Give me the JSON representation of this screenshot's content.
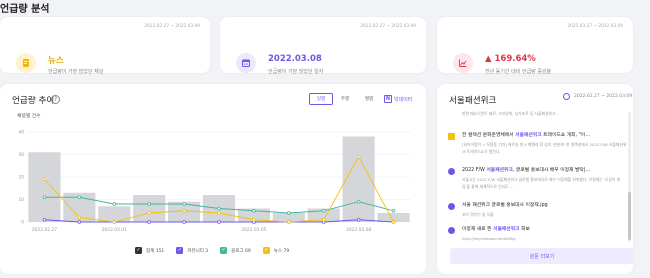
{
  "page": {
    "title": "언급량 분석"
  },
  "kpis": [
    {
      "date": "2022.02.27 ~ 2022.03.09",
      "value": "뉴스",
      "desc": "언급량이 가장 많았던 채널",
      "color": "#f3b515"
    },
    {
      "date": "2022.02.27 ~ 2022.03.09",
      "value": "2022.03.08",
      "desc": "언급량이 가장 많았던 일자",
      "color": "#6e58e9"
    },
    {
      "date": "2021.03.27 ~ 2022.03.09",
      "value": "▲ 169.64%",
      "desc": "전년 동기간 대비 언급량 증감율",
      "color": "#e0364a"
    }
  ],
  "trend": {
    "title": "언급량 추이",
    "help": "?",
    "tabs": [
      "일별",
      "주별",
      "월별"
    ],
    "active_tab": "일별",
    "bigdata_icon": "N",
    "bigdata_label": "빅데이터",
    "y_label": "채널별 건수"
  },
  "chart_data": {
    "type": "bar",
    "x": [
      "2022.02.27",
      "2022.02.28",
      "2022.03.01",
      "2022.03.02",
      "2022.03.03",
      "2022.03.04",
      "2022.03.05",
      "2022.03.06",
      "2022.03.07",
      "2022.03.08",
      "2022.03.09"
    ],
    "x_tick_labels": [
      "2022.02.27",
      "2022.03.01",
      "2022.03.05",
      "2022.03.08"
    ],
    "x_tick_index": [
      0,
      2,
      6,
      9
    ],
    "y_ticks": [
      0,
      10,
      20,
      30,
      40
    ],
    "ylim": [
      0,
      40
    ],
    "series": [
      {
        "name": "합계",
        "count": "151",
        "type": "bar",
        "color": "#d4d6da",
        "values": [
          31,
          13,
          7,
          12,
          9,
          12,
          6,
          4,
          6,
          38,
          4
        ]
      },
      {
        "name": "커뮤니티",
        "count": "3",
        "type": "line",
        "color": "#6e58e9",
        "values": [
          1,
          0,
          0,
          0,
          0,
          0,
          0,
          0,
          0,
          1,
          0
        ]
      },
      {
        "name": "블로그",
        "count": "69",
        "type": "line",
        "color": "#3fb89b",
        "values": [
          11,
          11,
          8,
          8,
          8,
          6,
          5,
          4,
          5,
          9,
          5
        ]
      },
      {
        "name": "뉴스",
        "count": "79",
        "type": "line",
        "color": "#f3c10e",
        "values": [
          19,
          2,
          0,
          4,
          5,
          4,
          1,
          0,
          1,
          29,
          0
        ]
      }
    ]
  },
  "posts": {
    "title": "서울패션위크",
    "date": "2022.02.27 ~ 2022.03.09",
    "items": [
      {
        "icon": "yellow",
        "title": "",
        "excerpt": "한편 메뉴디언트 돼르, 크리앙화, 성가포르 등 서울패션위크 .."
      },
      {
        "icon": "yellow",
        "title": "한 컬렉션 문화운영체에서 서울패션위크 트레이드쇼 개최, \"이…",
        "excerpt": "[와이어알치 = 옥용동 기자] 에르송 셀 4 패엘레 정 성지 '한분화' 한 컬렉션에서 2022 F/W 서울패션위크 트레이드쇼가 열린다."
      },
      {
        "icon": "purple",
        "title": "2022 F/W 서울패션위크, 글로벌 홍보대사 배우 이정재 발탁|…",
        "excerpt": "서울시는 2022 F/W 서울패션위크 글로벌 홍보대사로 배우 이정재를 위촉했다. 이정재는 '오징어 게임'을 통해 세계적으로 인지도 ..."
      },
      {
        "icon": "purple",
        "title": "서울 패션위크 글로벌 홍보대사 이정재.jpg",
        "excerpt": "포브 명키기 및 식물"
      },
      {
        "icon": "purple",
        "title": "이정재 새로 뜬 서울패션위크 화보",
        "excerpt": "http://img.theqoo.net/lofi/kg"
      }
    ],
    "more_label": "원문 더보기"
  },
  "colors": {
    "accent": "#6e58e9",
    "yellow": "#f3c10e",
    "green": "#3fb89b",
    "red": "#e0364a",
    "bar": "#d4d6da"
  }
}
